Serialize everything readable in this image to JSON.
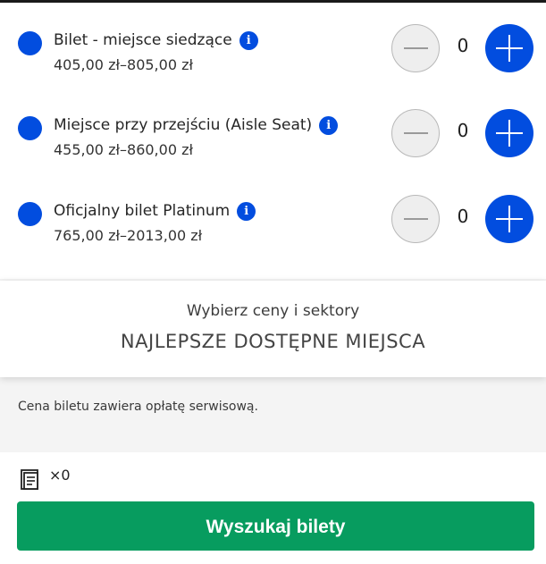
{
  "tickets": [
    {
      "name": "Bilet - miejsce siedzące",
      "price": "405,00 zł–805,00 zł",
      "quantity": "0"
    },
    {
      "name": "Miejsce przy przejściu (Aisle Seat)",
      "price": "455,00 zł–860,00 zł",
      "quantity": "0"
    },
    {
      "name": "Oficjalny bilet Platinum",
      "price": "765,00 zł–2013,00 zł",
      "quantity": "0"
    }
  ],
  "info_glyph": "i",
  "best_seats": {
    "subtitle": "Wybierz ceny i sektory",
    "title": "NAJLEPSZE DOSTĘPNE MIEJSCA"
  },
  "fee_note": "Cena biletu zawiera opłatę serwisową.",
  "footer": {
    "ticket_count": "×0",
    "search_button": "Wyszukaj bilety"
  },
  "colors": {
    "accent_blue": "#024ddf",
    "button_green": "#079c5f"
  }
}
